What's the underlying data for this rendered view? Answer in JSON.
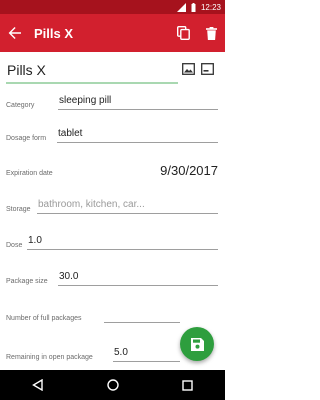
{
  "status_bar": {
    "time": "12:23"
  },
  "app_bar": {
    "title": "Pills X"
  },
  "form": {
    "name": {
      "value": "Pills X"
    },
    "category": {
      "label": "Category",
      "value": "sleeping pill"
    },
    "dosage_form": {
      "label": "Dosage form",
      "value": "tablet"
    },
    "expiration_date": {
      "label": "Expiration date",
      "value": "9/30/2017"
    },
    "storage": {
      "label": "Storage",
      "placeholder": "bathroom, kitchen, car..."
    },
    "dose": {
      "label": "Dose",
      "value": "1.0"
    },
    "package_size": {
      "label": "Package size",
      "value": "30.0"
    },
    "full_packages": {
      "label": "Number of full packages",
      "value": ""
    },
    "remaining": {
      "label": "Remaining in open package",
      "value": "5.0"
    }
  },
  "colors": {
    "status_bar": "#a6121d",
    "app_bar": "#d2202e",
    "fab": "#2e9e3e",
    "name_underline": "#a9d8b1"
  },
  "icons": {
    "back": "arrow-back-icon",
    "copy": "copy-icon",
    "delete": "trash-icon",
    "photo": "image-icon",
    "note": "note-icon",
    "fab": "save-icon"
  }
}
